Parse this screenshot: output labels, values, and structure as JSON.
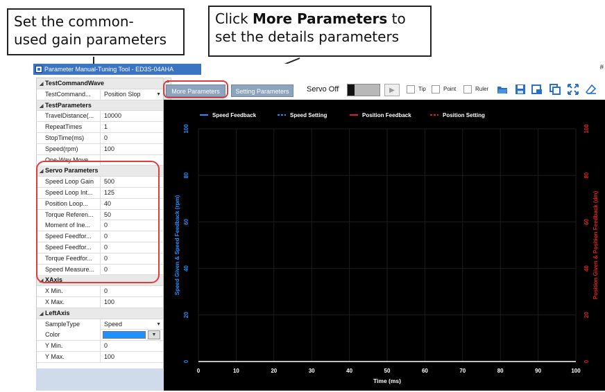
{
  "callouts": {
    "left_line1": "Set the common-",
    "left_line2": "used gain parameters",
    "right_prefix": "Click ",
    "right_bold": "More Parameters",
    "right_suffix": " to",
    "right_line2": "set the details parameters"
  },
  "window": {
    "title": "Parameter Manual-Tuning Tool - ED3S-04AHA",
    "pin_glyph": "#"
  },
  "propgrid": {
    "categories": [
      {
        "label": "TestCommandWave",
        "rows": [
          {
            "label": "TestCommand...",
            "value": "Position Slop",
            "dropdown": true
          }
        ]
      },
      {
        "label": "TestParameters",
        "rows": [
          {
            "label": "TravelDistance(...",
            "value": "10000"
          },
          {
            "label": "RepeatTimes",
            "value": "1"
          },
          {
            "label": "StopTime(ms)",
            "value": "0"
          },
          {
            "label": "Speed(rpm)",
            "value": "100"
          },
          {
            "label": "One-Way Move",
            "value": ""
          }
        ]
      },
      {
        "label": "Servo Parameters",
        "rows": [
          {
            "label": "Speed Loop Gain",
            "value": "500"
          },
          {
            "label": "Speed Loop Int...",
            "value": "125"
          },
          {
            "label": "Position Loop...",
            "value": "40"
          },
          {
            "label": "Torque Referen...",
            "value": "50"
          },
          {
            "label": "Moment of Ine...",
            "value": "0"
          },
          {
            "label": "Speed Feedfor...",
            "value": "0"
          },
          {
            "label": "Speed Feedfor...",
            "value": "0"
          },
          {
            "label": "Torque Feedfor...",
            "value": "0"
          },
          {
            "label": "Speed Measure...",
            "value": "0"
          }
        ]
      },
      {
        "label": "XAxis",
        "rows": [
          {
            "label": "X Min.",
            "value": "0"
          },
          {
            "label": "X Max.",
            "value": "100"
          }
        ]
      },
      {
        "label": "LeftAxis",
        "rows": [
          {
            "label": "SampleType",
            "value": "Speed",
            "dropdown": true
          },
          {
            "label": "Color",
            "value": "",
            "color": "#1e90ff"
          },
          {
            "label": "Y Min.",
            "value": "0"
          },
          {
            "label": "Y Max.",
            "value": "100"
          }
        ]
      }
    ]
  },
  "toolbar": {
    "more_params": "More Parameters",
    "setting_params": "Setting Parameters",
    "servo_label": "Servo Off",
    "play_glyph": "▶",
    "tip": "Tip",
    "point": "Point",
    "ruler": "Ruler",
    "icons": [
      "open-folder-icon",
      "save-icon",
      "export-icon",
      "copy-icon",
      "fit-view-icon",
      "clear-icon"
    ]
  },
  "chart_data": {
    "type": "line",
    "title": "",
    "legend": [
      "Speed Feedback",
      "Speed Setting",
      "Position Feedback",
      "Position Setting"
    ],
    "legend_colors": [
      "#1e90ff",
      "#1e90ff",
      "#e02020",
      "#e02020"
    ],
    "legend_placement": "top",
    "xlabel": "Time (ms)",
    "ylabel_left": "Speed Given & Speed Feedback (rpm)",
    "ylabel_right": "Position Given & Position Feedback (dm)",
    "x_ticks": [
      "0",
      "10",
      "20",
      "30",
      "40",
      "50",
      "60",
      "70",
      "80",
      "90",
      "100"
    ],
    "y_ticks": [
      "0",
      "20",
      "40",
      "60",
      "80",
      "100"
    ],
    "xlim": [
      0,
      100
    ],
    "ylim_left": [
      0,
      100
    ],
    "ylim_right": [
      0,
      100
    ],
    "grid": true,
    "series": [],
    "colors": {
      "left_axis": "#1e90ff",
      "right_axis": "#e02020",
      "background": "#000000",
      "grid": "#1c1c1c"
    }
  }
}
